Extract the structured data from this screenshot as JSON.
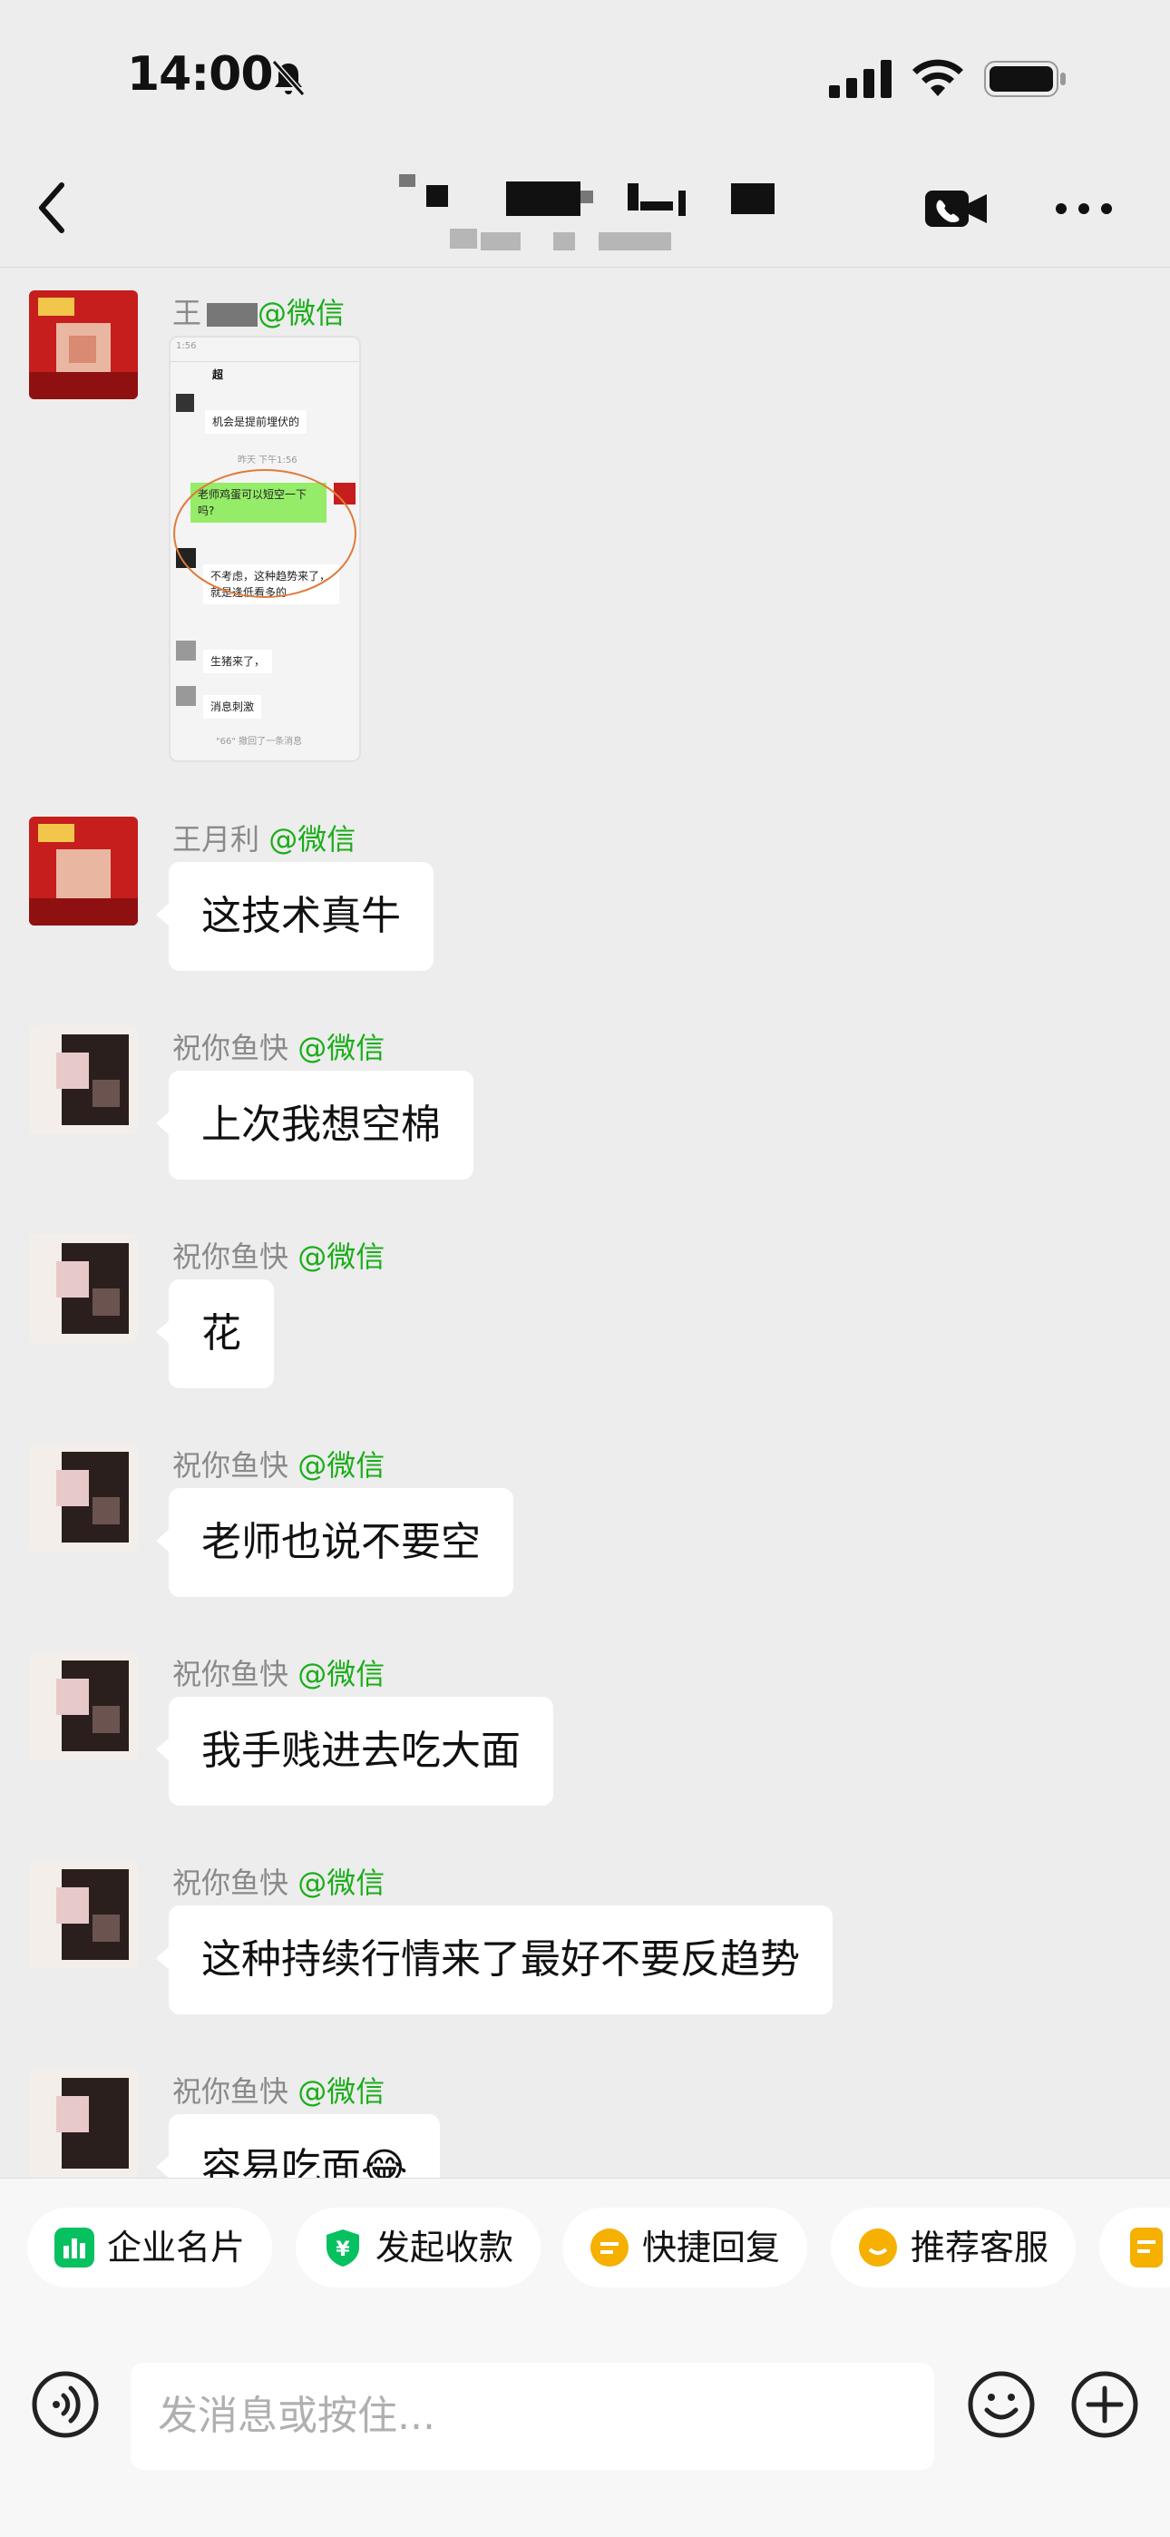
{
  "status_bar": {
    "time": "14:00"
  },
  "header": {
    "title": ""
  },
  "messages": [
    {
      "sender": "王",
      "platform": "@微信",
      "text": ""
    },
    {
      "sender": "王月利",
      "platform": "@微信",
      "text": "这技术真牛"
    },
    {
      "sender": "祝你鱼快",
      "platform": "@微信",
      "text": "上次我想空棉"
    },
    {
      "sender": "祝你鱼快",
      "platform": "@微信",
      "text": "花"
    },
    {
      "sender": "祝你鱼快",
      "platform": "@微信",
      "text": "老师也说不要空"
    },
    {
      "sender": "祝你鱼快",
      "platform": "@微信",
      "text": "我手贱进去吃大面"
    },
    {
      "sender": "祝你鱼快",
      "platform": "@微信",
      "text": "这种持续行情来了最好不要反趋势"
    },
    {
      "sender": "祝你鱼快",
      "platform": "@微信",
      "text": "容易吃面😂"
    }
  ],
  "screenshot": {
    "title": "超",
    "msg1": "机会是提前埋伏的",
    "time": "昨天 下午1:56",
    "msg2": "老师鸡蛋可以短空一下吗?",
    "msg3": "不考虑，这种趋势来了，就是逢低看多的",
    "msg4": "生猪来了，",
    "msg5": "消息刺激",
    "recall": "\"66\" 撤回了一条消息"
  },
  "quick_actions": [
    {
      "label": "企业名片",
      "color": "#07c160"
    },
    {
      "label": "发起收款",
      "color": "#07c160"
    },
    {
      "label": "快捷回复",
      "color": "#f5b000"
    },
    {
      "label": "推荐客服",
      "color": "#f5b000"
    }
  ],
  "input": {
    "placeholder": "发消息或按住..."
  }
}
